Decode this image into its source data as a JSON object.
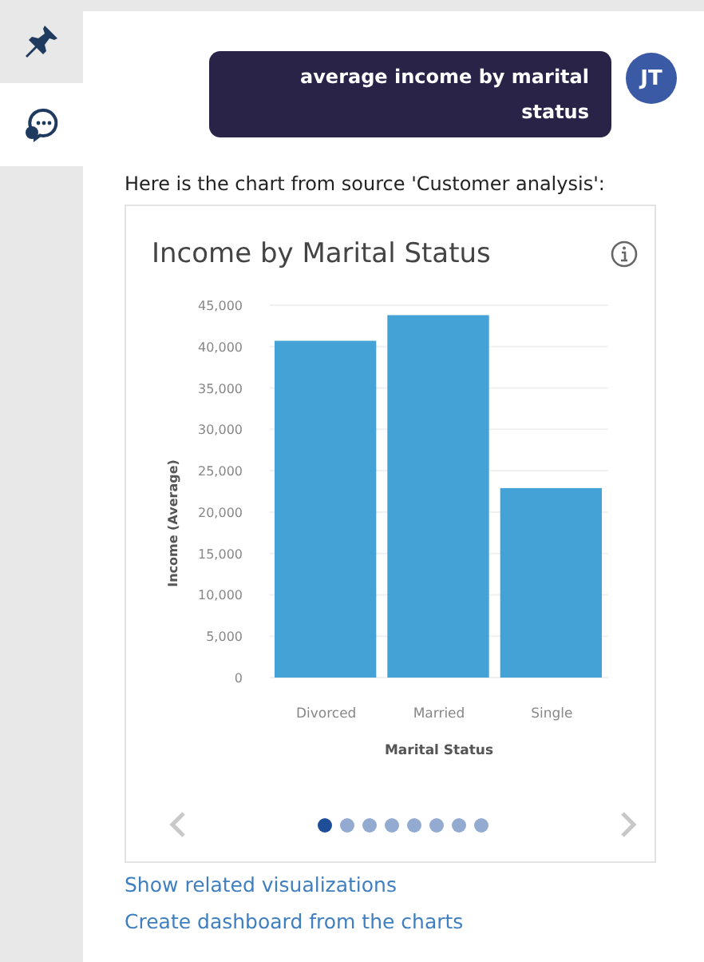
{
  "sidebar": {
    "items": [
      {
        "kind": "pin",
        "selected": false
      },
      {
        "kind": "chat",
        "selected": true
      }
    ]
  },
  "message": {
    "text": "average income by marital status",
    "avatar": "JT"
  },
  "reply": "Here is the chart from source 'Customer analysis':",
  "card": {
    "title": "Income by Marital Status",
    "chart_data": {
      "type": "bar",
      "xlabel": "Marital Status",
      "ylabel": "Income (Average)",
      "categories": [
        "Divorced",
        "Married",
        "Single"
      ],
      "series": [
        {
          "color": "#45a2d6",
          "values": [
            40700,
            43800,
            22900
          ]
        }
      ],
      "grid": true,
      "ylim": [
        0,
        45000
      ],
      "yticks": [
        {
          "value": 0,
          "label": "0"
        },
        {
          "value": 5000,
          "label": "5,000"
        },
        {
          "value": 10000,
          "label": "10,000"
        },
        {
          "value": 15000,
          "label": "15,000"
        },
        {
          "value": 20000,
          "label": "20,000"
        },
        {
          "value": 25000,
          "label": "25,000"
        },
        {
          "value": 30000,
          "label": "30,000"
        },
        {
          "value": 35000,
          "label": "35,000"
        },
        {
          "value": 40000,
          "label": "40,000"
        },
        {
          "value": 45000,
          "label": "45,000"
        }
      ]
    },
    "pages": [
      {
        "selected": true
      },
      {
        "selected": false
      },
      {
        "selected": false
      },
      {
        "selected": false
      },
      {
        "selected": false
      },
      {
        "selected": false
      },
      {
        "selected": false
      },
      {
        "selected": false
      }
    ]
  },
  "links": [
    "Show related visualizations",
    "Create dashboard from the charts"
  ]
}
